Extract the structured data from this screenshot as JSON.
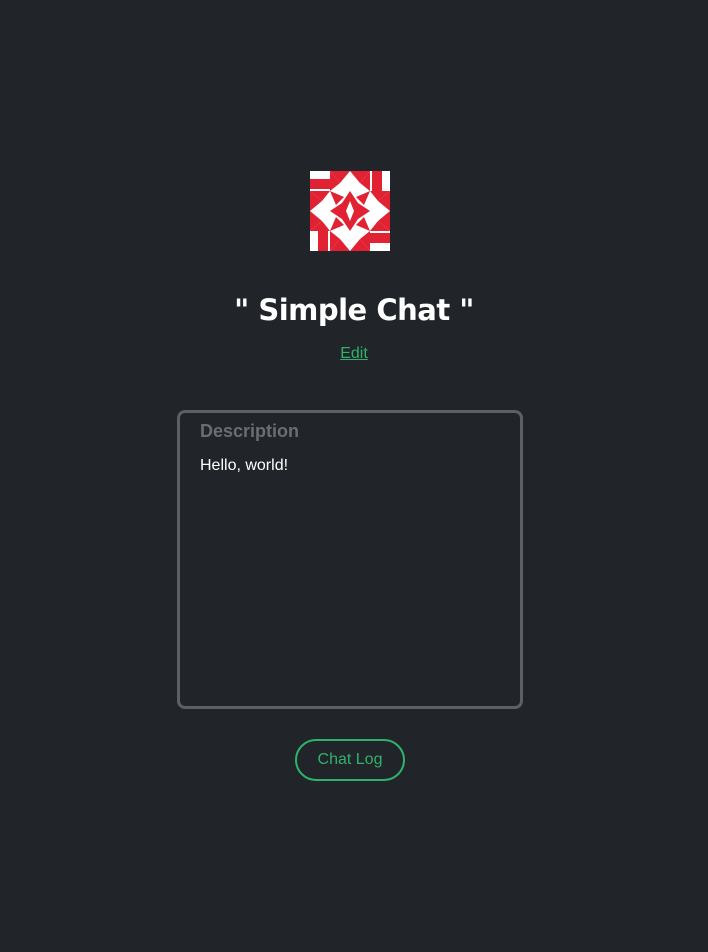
{
  "avatar": {
    "icon": "identicon-star-pattern",
    "color": "#e02232",
    "background": "#ffffff"
  },
  "page_title": "\" Simple Chat \"",
  "edit_link": "Edit",
  "description": {
    "label": "Description",
    "text": "Hello, world!"
  },
  "chat_log_button": "Chat Log",
  "colors": {
    "background": "#212429",
    "accent": "#2fb36a",
    "border": "#5d5f63",
    "text": "#ffffff",
    "muted": "#6b6d70"
  }
}
